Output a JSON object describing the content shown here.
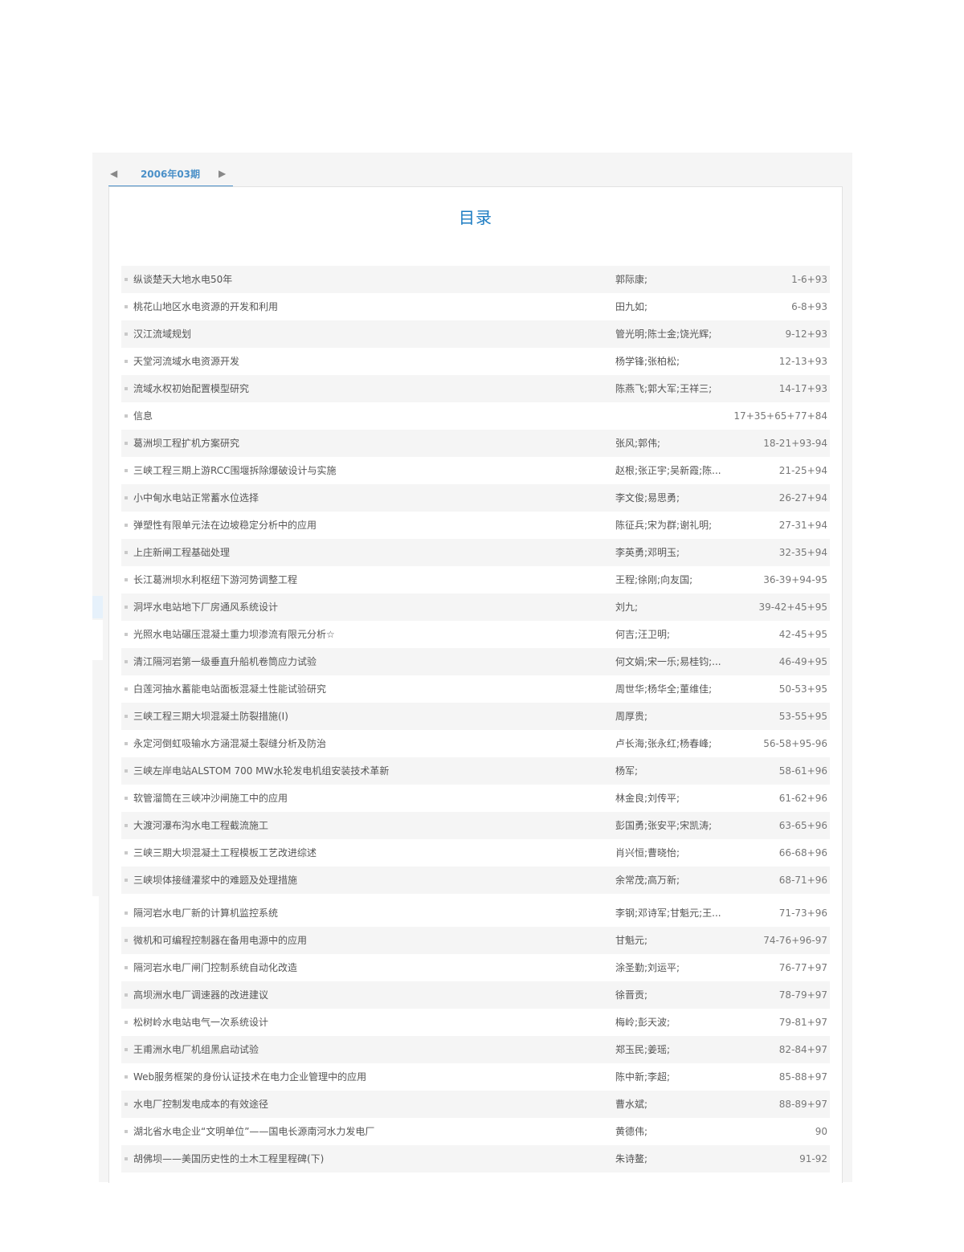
{
  "issue_tab": {
    "prev_icon": "triangle-left-icon",
    "label": "2006年03期",
    "next_icon": "triangle-right-icon"
  },
  "toc": {
    "title": "目录",
    "rows": [
      {
        "title": "纵谈楚天大地水电50年",
        "authors": "郭际康;",
        "pages": "1-6+93"
      },
      {
        "title": "桃花山地区水电资源的开发和利用",
        "authors": "田九如;",
        "pages": "6-8+93"
      },
      {
        "title": "汉江流域规划",
        "authors": "管光明;陈士金;饶光辉;",
        "pages": "9-12+93"
      },
      {
        "title": "天堂河流域水电资源开发",
        "authors": "杨学锋;张柏松;",
        "pages": "12-13+93"
      },
      {
        "title": "流域水权初始配置模型研究",
        "authors": "陈燕飞;郭大军;王祥三;",
        "pages": "14-17+93"
      },
      {
        "title": "信息",
        "authors": "",
        "pages": "17+35+65+77+84"
      },
      {
        "title": "葛洲坝工程扩机方案研究",
        "authors": "张风;郭伟;",
        "pages": "18-21+93-94"
      },
      {
        "title": "三峡工程三期上游RCC围堰拆除爆破设计与实施",
        "authors": "赵根;张正宇;吴新霞;陈...",
        "pages": "21-25+94"
      },
      {
        "title": "小中甸水电站正常蓄水位选择",
        "authors": "李文俊;易思勇;",
        "pages": "26-27+94"
      },
      {
        "title": "弹塑性有限单元法在边坡稳定分析中的应用",
        "authors": "陈征兵;宋为群;谢礼明;",
        "pages": "27-31+94"
      },
      {
        "title": "上庄新闸工程基础处理",
        "authors": "李英勇;邓明玉;",
        "pages": "32-35+94"
      },
      {
        "title": "长江葛洲坝水利枢纽下游河势调整工程",
        "authors": "王程;徐刚;向友国;",
        "pages": "36-39+94-95"
      },
      {
        "title": "洞坪水电站地下厂房通风系统设计",
        "authors": "刘九;",
        "pages": "39-42+45+95"
      },
      {
        "title": "光照水电站碾压混凝土重力坝渗流有限元分析☆",
        "authors": "何吉;汪卫明;",
        "pages": "42-45+95"
      },
      {
        "title": "清江隔河岩第一级垂直升船机卷筒应力试验",
        "authors": "何文娟;宋一乐;易桂钧;...",
        "pages": "46-49+95"
      },
      {
        "title": "白莲河抽水蓄能电站面板混凝土性能试验研究",
        "authors": "周世华;杨华全;董维佳;",
        "pages": "50-53+95"
      },
      {
        "title": "三峡工程三期大坝混凝土防裂措施(Ⅰ)",
        "authors": "周厚贵;",
        "pages": "53-55+95"
      },
      {
        "title": "永定河倒虹吸输水方涵混凝土裂缝分析及防治",
        "authors": "卢长海;张永红;杨春峰;",
        "pages": "56-58+95-96"
      },
      {
        "title": "三峡左岸电站ALSTOM 700 MW水轮发电机组安装技术革新",
        "authors": "杨军;",
        "pages": "58-61+96"
      },
      {
        "title": "软管溜筒在三峡冲沙闸施工中的应用",
        "authors": "林金良;刘传平;",
        "pages": "61-62+96"
      },
      {
        "title": "大渡河瀑布沟水电工程截流施工",
        "authors": "彭国勇;张安平;宋凯涛;",
        "pages": "63-65+96"
      },
      {
        "title": "三峡三期大坝混凝土工程模板工艺改进综述",
        "authors": "肖兴恒;曹晓怡;",
        "pages": "66-68+96"
      },
      {
        "title": "三峡坝体接缝灌浆中的难题及处理措施",
        "authors": "余常茂;高万新;",
        "pages": "68-71+96"
      },
      {
        "title": "隔河岩水电厂新的计算机监控系统",
        "authors": "李钢;邓诗军;甘魁元;王...",
        "pages": "71-73+96"
      },
      {
        "title": "微机和可编程控制器在备用电源中的应用",
        "authors": "甘魁元;",
        "pages": "74-76+96-97"
      },
      {
        "title": "隔河岩水电厂闸门控制系统自动化改造",
        "authors": "涂圣勤;刘运平;",
        "pages": "76-77+97"
      },
      {
        "title": "高坝洲水电厂调速器的改进建议",
        "authors": "徐晋贡;",
        "pages": "78-79+97"
      },
      {
        "title": "松树岭水电站电气一次系统设计",
        "authors": "梅岭;彭天波;",
        "pages": "79-81+97"
      },
      {
        "title": "王甫洲水电厂机组黑启动试验",
        "authors": "郑玉民;姜瑶;",
        "pages": "82-84+97"
      },
      {
        "title": "Web服务框架的身份认证技术在电力企业管理中的应用",
        "authors": "陈中新;李超;",
        "pages": "85-88+97"
      },
      {
        "title": "水电厂控制发电成本的有效途径",
        "authors": "曹水斌;",
        "pages": "88-89+97"
      },
      {
        "title": "湖北省水电企业“文明单位”——国电长源南河水力发电厂",
        "authors": "黄德伟;",
        "pages": "90"
      },
      {
        "title": "胡佛坝——美国历史性的土木工程里程碑(下)",
        "authors": "朱诗鳌;",
        "pages": "91-92"
      }
    ]
  }
}
